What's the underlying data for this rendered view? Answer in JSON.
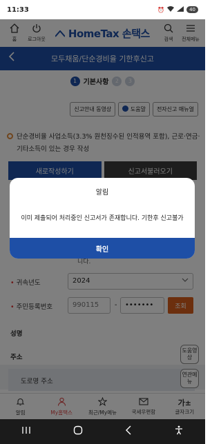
{
  "status": {
    "time": "11:33",
    "battery": "40"
  },
  "header": {
    "home_label": "홈",
    "logout_label": "로그아웃",
    "logo_text": "HomeTax 손택스",
    "search_label": "검색",
    "menu_label": "전체메뉴"
  },
  "page": {
    "title": "모두채움/단순경비율 기한후신고",
    "step_current": "기본사항",
    "step_current_num": "1",
    "step2": "2",
    "step3": "3"
  },
  "links": {
    "video": "신고안내 동영상",
    "help": "도움말",
    "manual": "전자신고 매뉴얼"
  },
  "notice": "단순경비율 사업소득(3.3% 원천징수된 인적용역 포함), 근로·연금·기타소득이 있는 경우 작성",
  "actions": {
    "new_write": "새로작성하기",
    "load_report": "신고서불러오기"
  },
  "form": {
    "partial_text": "니다.",
    "year_label": "귀속년도",
    "year_value": "2024",
    "rrn_label": "주민등록번호",
    "rrn_front": "990115",
    "rrn_dash": "-",
    "rrn_back": "•••••••",
    "lookup_label": "조회",
    "name_label": "성명",
    "address_label": "주소",
    "road_address_label": "도로명 주소"
  },
  "side": {
    "help_video": "도움영상",
    "related_menu": "연관메뉴"
  },
  "bottom_nav": [
    {
      "label": "알림",
      "icon": "bell-icon"
    },
    {
      "label": "My홈택스",
      "icon": "person-icon"
    },
    {
      "label": "최근/My메뉴",
      "icon": "star-icon"
    },
    {
      "label": "국세우편함",
      "icon": "mail-icon"
    },
    {
      "label": "글자크기",
      "icon": "font-size-icon"
    }
  ],
  "dialog": {
    "title": "알림",
    "message": "이미 제출되어 처리중인 신고서가 존재합니다. 기한후 신고불가",
    "ok": "확인"
  },
  "colors": {
    "brand": "#1e4fa6",
    "lookup": "#d95f1c",
    "active_nav": "#d94141"
  }
}
